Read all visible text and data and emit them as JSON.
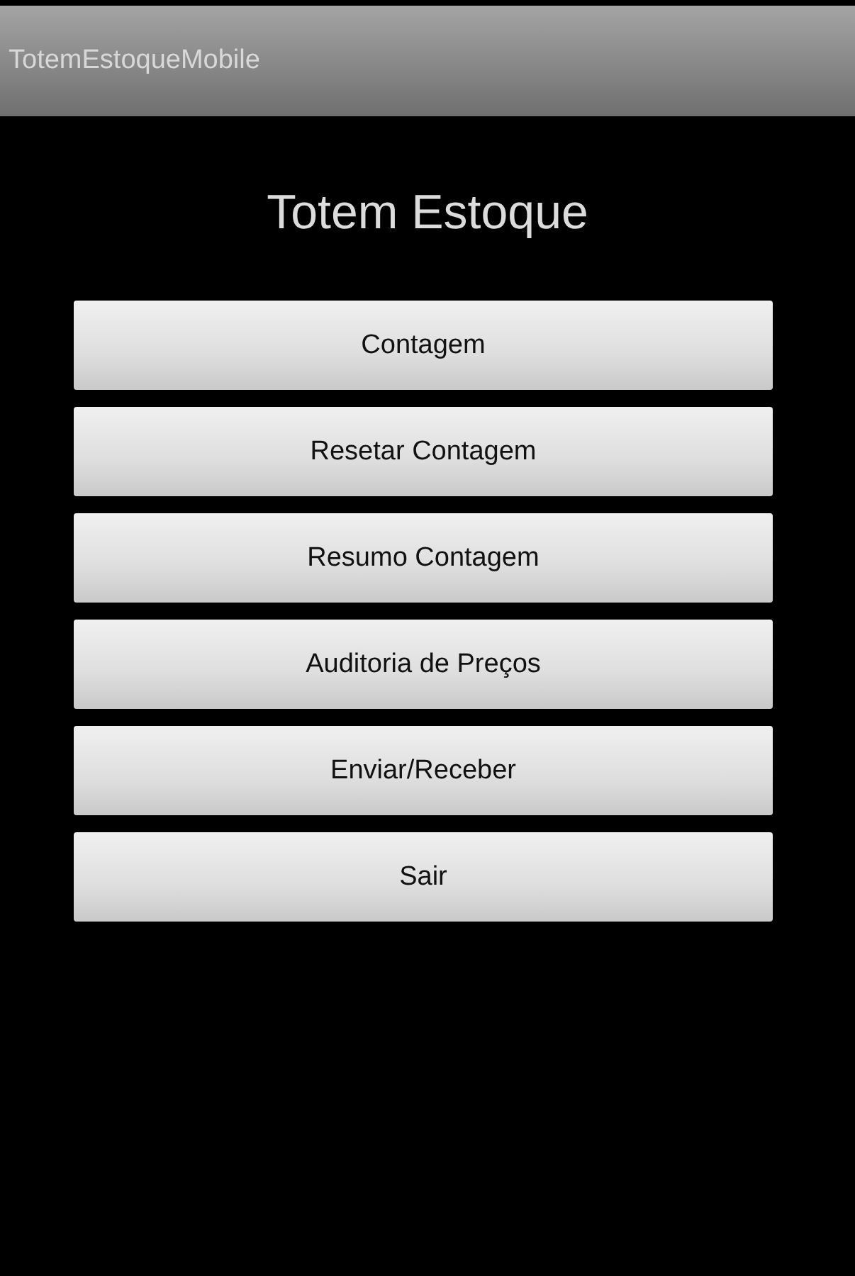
{
  "action_bar": {
    "title": "TotemEstoqueMobile"
  },
  "heading": "Totem Estoque",
  "buttons": [
    "Contagem",
    "Resetar Contagem",
    "Resumo Contagem",
    "Auditoria de Preços",
    "Enviar/Receber",
    "Sair"
  ]
}
